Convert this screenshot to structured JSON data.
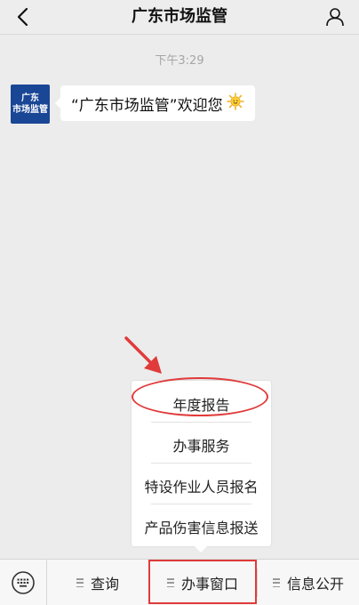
{
  "header": {
    "title": "广东市场监管",
    "back_icon": "chevron-left-icon",
    "profile_icon": "user-icon"
  },
  "chat": {
    "timestamp": "下午3:29",
    "avatar_lines": [
      "广东",
      "市场监管"
    ],
    "message": "“广东市场监管”欢迎您"
  },
  "popup_menu": {
    "items": [
      "年度报告",
      "办事服务",
      "特设作业人员报名",
      "产品伤害信息报送"
    ]
  },
  "bottom_menu": {
    "items": [
      "查询",
      "办事窗口",
      "信息公开"
    ]
  },
  "colors": {
    "accent_red": "#e03a3a",
    "avatar_blue": "#1a4696"
  }
}
